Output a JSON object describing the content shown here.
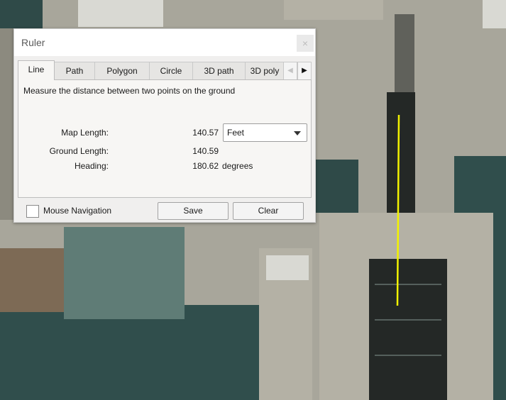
{
  "dialog": {
    "title": "Ruler",
    "close_glyph": "×",
    "tabs": [
      {
        "label": "Line",
        "active": true
      },
      {
        "label": "Path"
      },
      {
        "label": "Polygon"
      },
      {
        "label": "Circle"
      },
      {
        "label": "3D path"
      },
      {
        "label": "3D poly"
      }
    ],
    "tab_scroll_left_icon": "chevron-left-icon",
    "tab_scroll_right_icon": "chevron-right-icon",
    "description": "Measure the distance between two points on the ground",
    "map_length": {
      "label": "Map Length:",
      "value": "140.57"
    },
    "unit_select": {
      "selected": "Feet"
    },
    "ground_length": {
      "label": "Ground Length:",
      "value": "140.59"
    },
    "heading": {
      "label": "Heading:",
      "value": "180.62",
      "unit": "degrees"
    },
    "mouse_navigation": {
      "label": "Mouse Navigation",
      "checked": false
    },
    "save_label": "Save",
    "clear_label": "Clear"
  },
  "map": {
    "measure_line_color": "#f2f200"
  }
}
